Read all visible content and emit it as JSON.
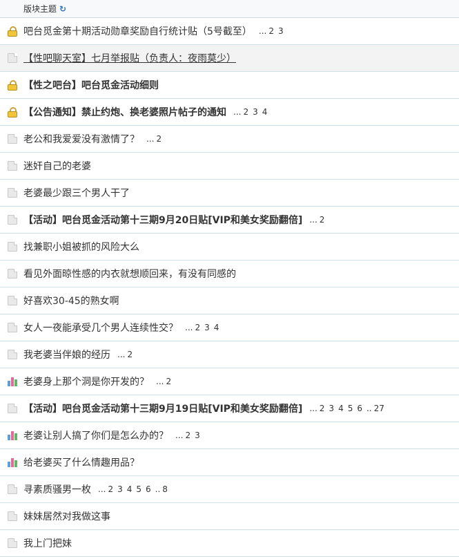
{
  "header": {
    "label": "版块主题"
  },
  "threads": [
    {
      "icon": "lock-icon",
      "title": "吧台觅金第十期活动勋章奖励自行统计贴（5号截至）",
      "bold": false,
      "underline": false,
      "alt": false,
      "pages": [
        "2",
        "3"
      ]
    },
    {
      "icon": "doc-icon",
      "title": "【性吧聊天室】七月举报贴（负责人：夜雨莫少）",
      "bold": false,
      "underline": true,
      "alt": true,
      "pages": []
    },
    {
      "icon": "lock-icon",
      "title": "【性之吧台】吧台觅金活动细则",
      "bold": true,
      "underline": false,
      "alt": false,
      "pages": []
    },
    {
      "icon": "lock-icon",
      "title": "【公告通知】禁止约炮、换老婆照片帖子的通知",
      "bold": true,
      "underline": false,
      "alt": false,
      "pages": [
        "2",
        "3",
        "4"
      ]
    },
    {
      "icon": "doc-icon",
      "title": "老公和我爱爱没有激情了？",
      "bold": false,
      "underline": false,
      "alt": false,
      "pages": [
        "2"
      ]
    },
    {
      "icon": "doc-icon",
      "title": "迷奸自己的老婆",
      "bold": false,
      "underline": false,
      "alt": false,
      "pages": []
    },
    {
      "icon": "doc-icon",
      "title": "老婆最少跟三个男人干了",
      "bold": false,
      "underline": false,
      "alt": false,
      "pages": []
    },
    {
      "icon": "doc-icon",
      "title": "【活动】吧台觅金活动第十三期9月20日贴[VIP和美女奖励翻倍]",
      "bold": true,
      "underline": false,
      "alt": false,
      "pages": [
        "2"
      ]
    },
    {
      "icon": "doc-icon",
      "title": "找兼职小姐被抓的风险大么",
      "bold": false,
      "underline": false,
      "alt": false,
      "pages": []
    },
    {
      "icon": "doc-icon",
      "title": "看见外面晾性感的内衣就想顺回来，有没有同感的",
      "bold": false,
      "underline": false,
      "alt": false,
      "pages": []
    },
    {
      "icon": "doc-icon",
      "title": "好喜欢30-45的熟女啊",
      "bold": false,
      "underline": false,
      "alt": false,
      "pages": []
    },
    {
      "icon": "doc-icon",
      "title": "女人一夜能承受几个男人连续性交？",
      "bold": false,
      "underline": false,
      "alt": false,
      "pages": [
        "2",
        "3",
        "4"
      ]
    },
    {
      "icon": "doc-icon",
      "title": "我老婆当伴娘的经历",
      "bold": false,
      "underline": false,
      "alt": false,
      "pages": [
        "2"
      ]
    },
    {
      "icon": "poll-icon",
      "title": "老婆身上那个洞是你开发的？",
      "bold": false,
      "underline": false,
      "alt": false,
      "pages": [
        "2"
      ]
    },
    {
      "icon": "doc-icon",
      "title": "【活动】吧台觅金活动第十三期9月19日贴[VIP和美女奖励翻倍]",
      "bold": true,
      "underline": false,
      "alt": false,
      "pages": [
        "2",
        "3",
        "4",
        "5",
        "6",
        "..",
        "27"
      ]
    },
    {
      "icon": "poll-icon",
      "title": "老婆让别人搞了你们是怎么办的？",
      "bold": false,
      "underline": false,
      "alt": false,
      "pages": [
        "2",
        "3"
      ]
    },
    {
      "icon": "poll-icon",
      "title": "给老婆买了什么情趣用品？",
      "bold": false,
      "underline": false,
      "alt": false,
      "pages": []
    },
    {
      "icon": "doc-icon",
      "title": "寻素质骚男一枚",
      "bold": false,
      "underline": false,
      "alt": false,
      "pages": [
        "2",
        "3",
        "4",
        "5",
        "6",
        "..",
        "8"
      ]
    },
    {
      "icon": "doc-icon",
      "title": "妹妹居然对我做这事",
      "bold": false,
      "underline": false,
      "alt": false,
      "pages": []
    },
    {
      "icon": "doc-icon",
      "title": "我上门把妹",
      "bold": false,
      "underline": false,
      "alt": false,
      "pages": []
    }
  ],
  "pager_prefix": "..."
}
